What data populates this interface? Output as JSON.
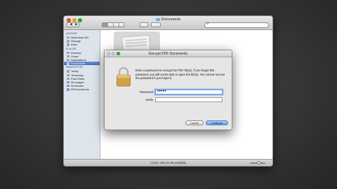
{
  "finder": {
    "title": "Documents",
    "sidebar": {
      "sections": [
        {
          "heading": "DEVICES",
          "items": [
            "Macintosh HD",
            "Storage",
            "iDisk"
          ]
        },
        {
          "heading": "PLACES",
          "items": [
            "Desktop",
            "Guest",
            "Applications",
            "Documents"
          ]
        },
        {
          "heading": "SEARCH FOR",
          "items": [
            "Today",
            "Yesterday",
            "Past Week",
            "All Images",
            "All Movies",
            "All Documents"
          ]
        }
      ],
      "selected": "Documents"
    },
    "status_text": "1 item, 169.23 GB available"
  },
  "dialog": {
    "title": "Encrypt PDF Documents",
    "message": "Enter a password to encrypt the PDF file(s). If you forget this password, you will not be able to open the file(s). You cannot recover the password if you forget it.",
    "password_label": "Password:",
    "password_value": "•••••",
    "verify_label": "Verify:",
    "verify_value": "",
    "cancel_label": "Cancel",
    "continue_label": "Continue"
  },
  "colors": {
    "accent": "#3f6cc2",
    "continue_button": "#5b9be6",
    "lock": "#c9a24a"
  },
  "icons": [
    "back-icon",
    "forward-icon",
    "icon-view-icon",
    "list-view-icon",
    "column-view-icon",
    "quicklook-eye-icon",
    "gear-icon",
    "search-icon",
    "lock-icon"
  ]
}
